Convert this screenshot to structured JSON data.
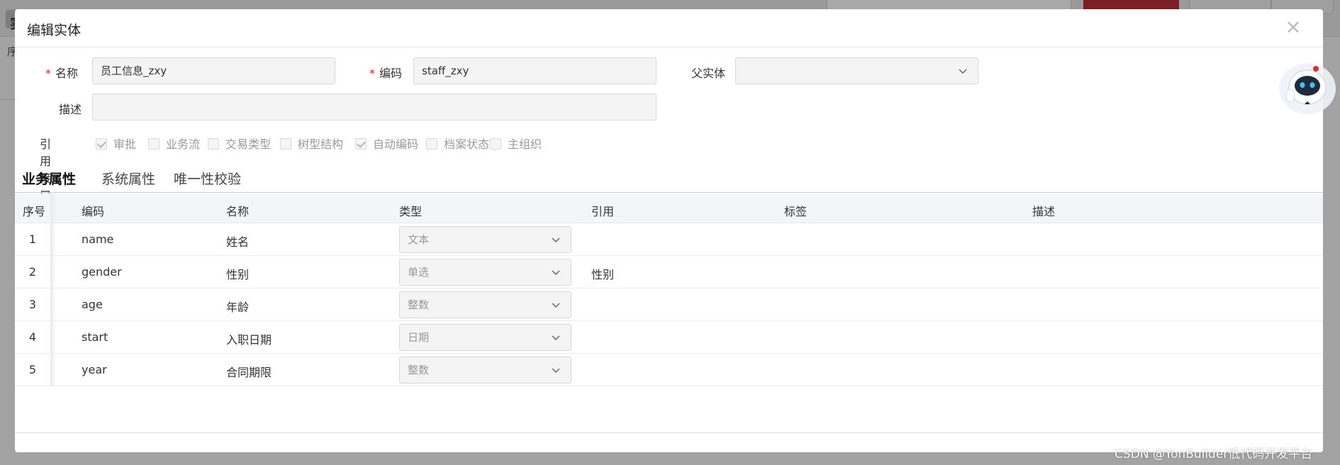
{
  "modal": {
    "title": "编辑实体",
    "close_label": "×"
  },
  "form": {
    "name": {
      "label": "名称",
      "required_mark": "*",
      "value": "员工信息_zxy"
    },
    "code": {
      "label": "编码",
      "required_mark": "*",
      "value": "staff_zxy"
    },
    "parent": {
      "label": "父实体",
      "value": ""
    },
    "description": {
      "label": "描述",
      "value": ""
    }
  },
  "interfaces": {
    "label": "引用接口",
    "items": [
      {
        "label": "审批",
        "checked": true
      },
      {
        "label": "业务流",
        "checked": false
      },
      {
        "label": "交易类型",
        "checked": false
      },
      {
        "label": "树型结构",
        "checked": false
      },
      {
        "label": "自动编码",
        "checked": true
      },
      {
        "label": "档案状态",
        "checked": false
      },
      {
        "label": "主组织",
        "checked": false
      }
    ]
  },
  "tabs": [
    {
      "label": "业务属性",
      "active": true
    },
    {
      "label": "系统属性",
      "active": false
    },
    {
      "label": "唯一性校验",
      "active": false
    }
  ],
  "table": {
    "headers": [
      "序号",
      "编码",
      "名称",
      "类型",
      "引用",
      "标签",
      "描述"
    ],
    "rows": [
      {
        "index": "1",
        "code": "name",
        "name": "姓名",
        "type": "文本",
        "ref": "",
        "tag": "",
        "desc": ""
      },
      {
        "index": "2",
        "code": "gender",
        "name": "性别",
        "type": "单选",
        "ref": "性别",
        "tag": "",
        "desc": ""
      },
      {
        "index": "3",
        "code": "age",
        "name": "年龄",
        "type": "整数",
        "ref": "",
        "tag": "",
        "desc": ""
      },
      {
        "index": "4",
        "code": "start",
        "name": "入职日期",
        "type": "日期",
        "ref": "",
        "tag": "",
        "desc": ""
      },
      {
        "index": "5",
        "code": "year",
        "name": "合同期限",
        "type": "整数",
        "ref": "",
        "tag": "",
        "desc": ""
      }
    ]
  },
  "background": {
    "title_char": "实",
    "sub_label": "序"
  },
  "watermark": "CSDN @YonBuilder低代码开发平台",
  "colors": {
    "accent": "#e02c2c",
    "required": "#e02020",
    "header_bg": "#f3f5f9"
  }
}
